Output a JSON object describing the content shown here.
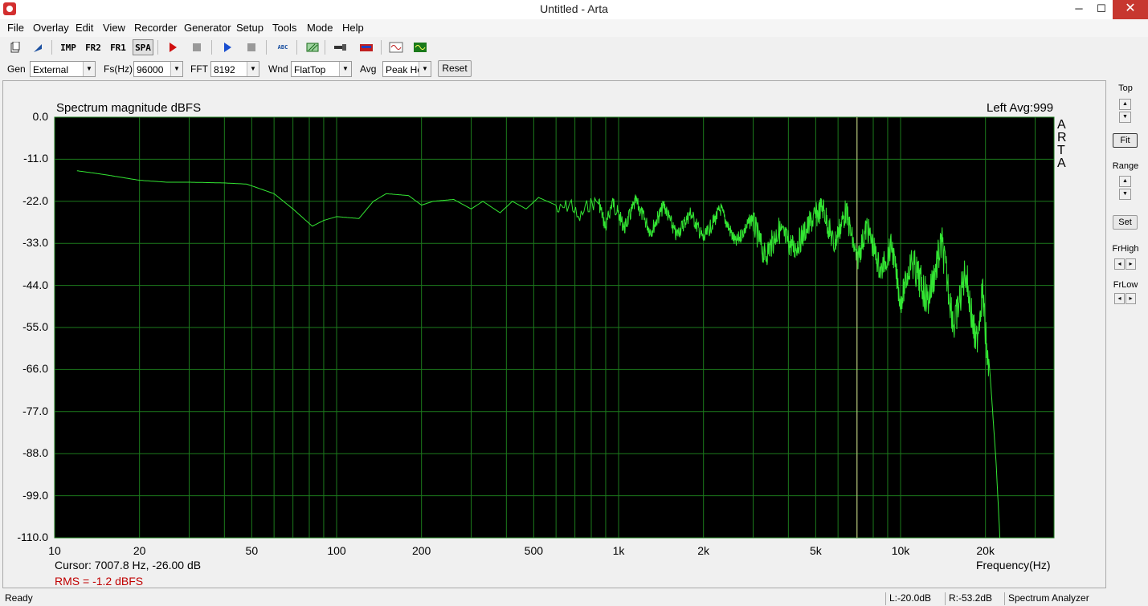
{
  "window": {
    "title": "Untitled - Arta",
    "min": "─",
    "max": "☐",
    "close": "✕"
  },
  "menu": [
    "File",
    "Overlay",
    "Edit",
    "View",
    "Recorder",
    "Generator",
    "Setup",
    "Tools",
    "Mode",
    "Help"
  ],
  "toolbar": {
    "imp": "IMP",
    "fr2": "FR2",
    "fr1": "FR1",
    "spa": "SPA",
    "abc": "ABC"
  },
  "params": {
    "gen_label": "Gen",
    "gen_value": "External",
    "fs_label": "Fs(Hz)",
    "fs_value": "96000",
    "fft_label": "FFT",
    "fft_value": "8192",
    "wnd_label": "Wnd",
    "wnd_value": "FlatTop",
    "avg_label": "Avg",
    "avg_value": "Peak Ho",
    "reset": "Reset"
  },
  "plot": {
    "title": "Spectrum magnitude dBFS",
    "info": "Left  Avg:999",
    "arta": [
      "A",
      "R",
      "T",
      "A"
    ],
    "freq_label": "Frequency(Hz)",
    "cursor": "Cursor:  7007.8 Hz, -26.00 dB",
    "rms": "RMS =   -1.2 dBFS"
  },
  "side": {
    "top": "Top",
    "fit": "Fit",
    "range": "Range",
    "set": "Set",
    "frhigh": "FrHigh",
    "frlow": "FrLow"
  },
  "status": {
    "ready": "Ready",
    "left": "L:-20.0dB",
    "right": "R:-53.2dB",
    "mode": "Spectrum Analyzer"
  },
  "colors": {
    "background": "#000000",
    "grid": "#1c7a1c",
    "trace": "#33e633",
    "cursor": "#d8d090",
    "rms": "#c00000"
  },
  "chart_data": {
    "type": "line",
    "xscale": "log",
    "xlim": [
      10,
      35000
    ],
    "ylim": [
      -110,
      0
    ],
    "ytick_labels": [
      "0.0",
      "-11.0",
      "-22.0",
      "-33.0",
      "-44.0",
      "-55.0",
      "-66.0",
      "-77.0",
      "-88.0",
      "-99.0",
      "-110.0"
    ],
    "yticks": [
      0,
      -11,
      -22,
      -33,
      -44,
      -55,
      -66,
      -77,
      -88,
      -99,
      -110
    ],
    "xtick_labels": [
      "10",
      "20",
      "50",
      "100",
      "200",
      "500",
      "1k",
      "2k",
      "5k",
      "10k",
      "20k"
    ],
    "xticks": [
      10,
      20,
      50,
      100,
      200,
      500,
      1000,
      2000,
      5000,
      10000,
      20000
    ],
    "cursor_x": 7007.8,
    "series": [
      {
        "points": [
          [
            12,
            -14
          ],
          [
            15,
            -15
          ],
          [
            20,
            -16.5
          ],
          [
            25,
            -17
          ],
          [
            30,
            -17
          ],
          [
            40,
            -17.2
          ],
          [
            48,
            -17.5
          ],
          [
            60,
            -20
          ],
          [
            70,
            -24
          ],
          [
            82,
            -28.5
          ],
          [
            90,
            -27
          ],
          [
            100,
            -26
          ],
          [
            120,
            -26.5
          ],
          [
            135,
            -22
          ],
          [
            150,
            -20
          ],
          [
            180,
            -20.5
          ],
          [
            200,
            -23
          ],
          [
            220,
            -22
          ],
          [
            260,
            -21.5
          ],
          [
            300,
            -24
          ],
          [
            330,
            -22
          ],
          [
            380,
            -25
          ],
          [
            420,
            -22
          ],
          [
            470,
            -24
          ],
          [
            520,
            -21
          ],
          [
            600,
            -23
          ],
          [
            680,
            -20.5
          ],
          [
            720,
            -25
          ],
          [
            780,
            -21
          ],
          [
            850,
            -20
          ],
          [
            900,
            -27
          ],
          [
            950,
            -20
          ],
          [
            1050,
            -27
          ],
          [
            1150,
            -20
          ],
          [
            1300,
            -28
          ],
          [
            1450,
            -21
          ],
          [
            1600,
            -29
          ],
          [
            1800,
            -23
          ],
          [
            2000,
            -30
          ],
          [
            2300,
            -22
          ],
          [
            2600,
            -31
          ],
          [
            3000,
            -24
          ],
          [
            3300,
            -33
          ],
          [
            3700,
            -26
          ],
          [
            4200,
            -31
          ],
          [
            4800,
            -24
          ],
          [
            5300,
            -20
          ],
          [
            5800,
            -30
          ],
          [
            6400,
            -21
          ],
          [
            7000,
            -34
          ],
          [
            7600,
            -25
          ],
          [
            8500,
            -37
          ],
          [
            9300,
            -30
          ],
          [
            10000,
            -45
          ],
          [
            11000,
            -33
          ],
          [
            12500,
            -43
          ],
          [
            14000,
            -28
          ],
          [
            15500,
            -50
          ],
          [
            17000,
            -35
          ],
          [
            18500,
            -55
          ],
          [
            19500,
            -40
          ],
          [
            20200,
            -56
          ],
          [
            20800,
            -68
          ],
          [
            21800,
            -90
          ],
          [
            22500,
            -110
          ]
        ]
      }
    ]
  }
}
